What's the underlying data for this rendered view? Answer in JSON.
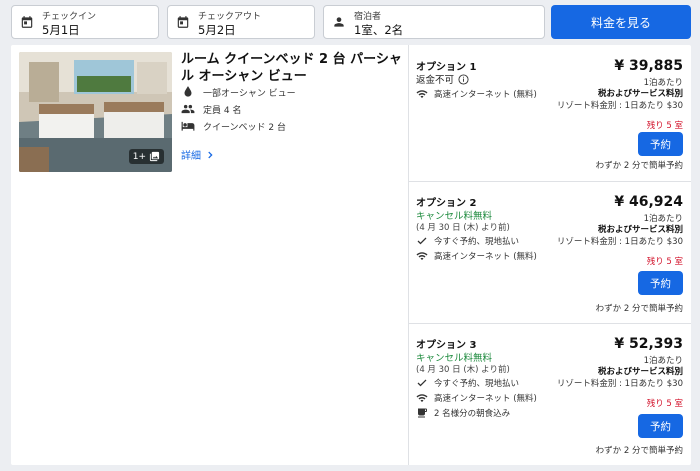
{
  "search": {
    "checkin": {
      "label": "チェックイン",
      "value": "5月1日"
    },
    "checkout": {
      "label": "チェックアウト",
      "value": "5月2日"
    },
    "guests": {
      "label": "宿泊者",
      "value": "1室、2名"
    },
    "price_button": "料金を見る"
  },
  "room": {
    "title": "ルーム クイーンベッド 2 台 パーシャル オーシャン ビュー",
    "photo_count": "1+",
    "features": [
      "一部オーシャン ビュー",
      "定員 4 名",
      "クイーンベッド 2 台"
    ],
    "details_link": "詳細"
  },
  "options": [
    {
      "title": "オプション 1",
      "refund": "返金不可",
      "amenities": [
        "高速インターネット (無料)"
      ],
      "price": "¥ 39,885",
      "per_night": "1泊あたり",
      "tax": "税およびサービス料別",
      "resort_fee": "リゾート料金別 : 1日あたり $30",
      "remaining": "残り 5 室",
      "reserve": "予約",
      "quick": "わずか 2 分で簡単予約"
    },
    {
      "title": "オプション 2",
      "refund": "キャンセル料無料",
      "refund_sub": "(4 月 30 日 (木) より前)",
      "amenities": [
        "今すぐ予約、現地払い",
        "高速インターネット (無料)"
      ],
      "price": "¥ 46,924",
      "per_night": "1泊あたり",
      "tax": "税およびサービス料別",
      "resort_fee": "リゾート料金別 : 1日あたり $30",
      "remaining": "残り 5 室",
      "reserve": "予約",
      "quick": "わずか 2 分で簡単予約"
    },
    {
      "title": "オプション 3",
      "refund": "キャンセル料無料",
      "refund_sub": "(4 月 30 日 (木) より前)",
      "amenities": [
        "今すぐ予約、現地払い",
        "高速インターネット (無料)",
        "2 名様分の朝食込み"
      ],
      "price": "¥ 52,393",
      "per_night": "1泊あたり",
      "tax": "税およびサービス料別",
      "resort_fee": "リゾート料金別 : 1日あたり $30",
      "remaining": "残り 5 室",
      "reserve": "予約",
      "quick": "わずか 2 分で簡単予約"
    }
  ],
  "colors": {
    "accent": "#1668e3",
    "success": "#1d8a3d",
    "alert": "#d3162e"
  }
}
